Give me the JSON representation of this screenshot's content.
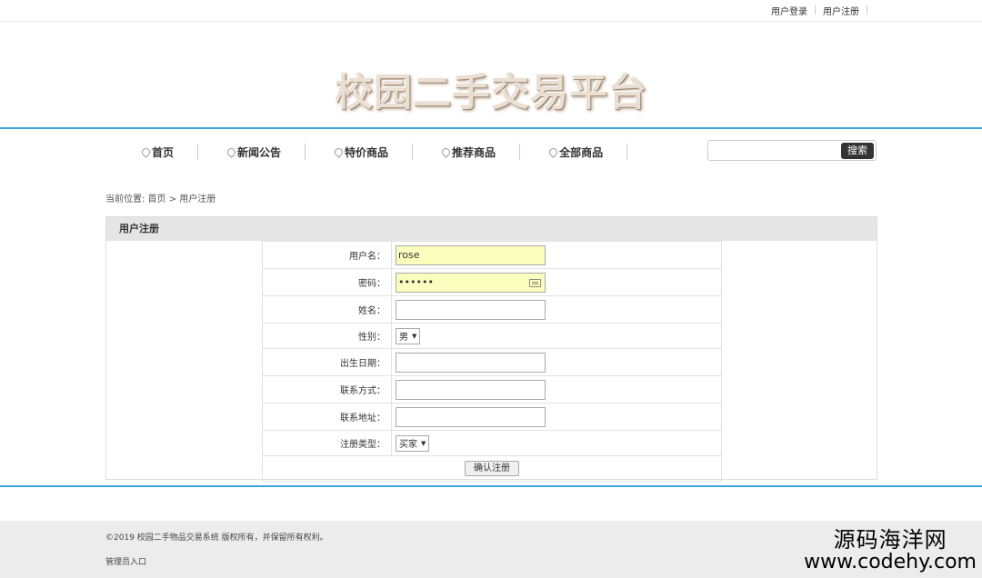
{
  "topbar": {
    "login": "用户登录",
    "register": "用户注册"
  },
  "site": {
    "title": "校园二手交易平台"
  },
  "nav": {
    "items": [
      {
        "label": "首页",
        "icon": "location-pin-icon"
      },
      {
        "label": "新闻公告",
        "icon": "location-pin-icon"
      },
      {
        "label": "特价商品",
        "icon": "location-pin-icon"
      },
      {
        "label": "推荐商品",
        "icon": "location-pin-icon"
      },
      {
        "label": "全部商品",
        "icon": "location-pin-icon"
      }
    ]
  },
  "search": {
    "value": "",
    "button": "搜索"
  },
  "breadcrumb": {
    "text": "当前位置: 首页 > 用户注册"
  },
  "panel": {
    "title": "用户注册"
  },
  "form": {
    "username_label": "用户名：",
    "username_value": "rose",
    "password_label": "密码：",
    "password_value": "••••••",
    "name_label": "姓名：",
    "name_value": "",
    "gender_label": "性别：",
    "gender_value": "男",
    "birth_label": "出生日期：",
    "birth_value": "",
    "contact_label": "联系方式：",
    "contact_value": "",
    "address_label": "联系地址：",
    "address_value": "",
    "type_label": "注册类型：",
    "type_value": "买家",
    "submit": "确认注册"
  },
  "footer": {
    "copyright": "©2019 校园二手物品交易系统 版权所有，并保留所有权利。",
    "admin": "管理员入口"
  },
  "watermark": {
    "cn": "源码海洋网",
    "en": "www.codehy.com"
  },
  "colors": {
    "accent": "#3aa5d9",
    "autofill": "#faffbd"
  }
}
